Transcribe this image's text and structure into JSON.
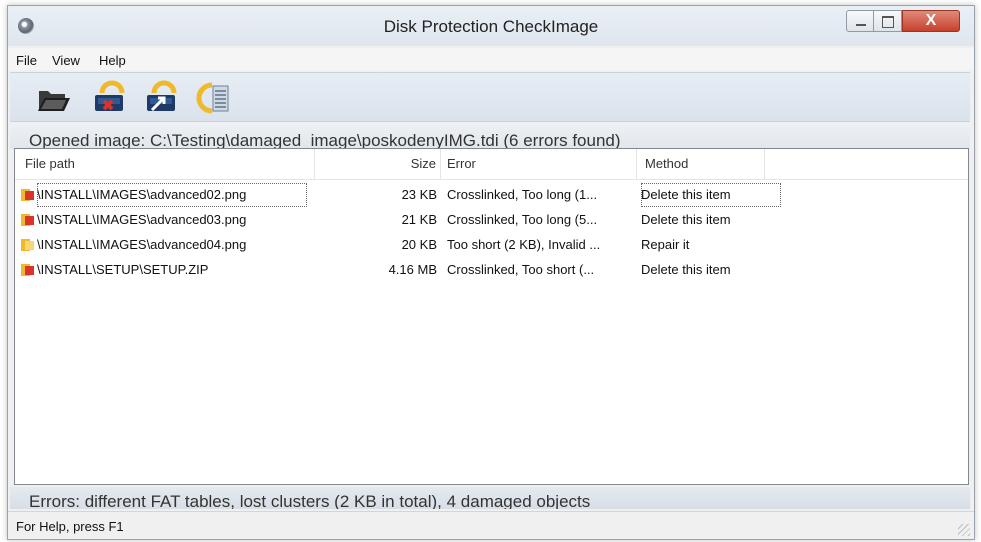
{
  "window": {
    "title": "Disk Protection CheckImage",
    "close_glyph": "X"
  },
  "menu": [
    "File",
    "View",
    "Help"
  ],
  "toolbar": {
    "buttons": [
      {
        "icon": "open-folder-icon"
      },
      {
        "icon": "delete-disk-icon"
      },
      {
        "icon": "repair-disk-icon"
      },
      {
        "icon": "disk-details-icon"
      }
    ]
  },
  "info": {
    "opened_text": "Opened image:  C:\\Testing\\damaged_image\\poskodenyIMG.tdi  (6 errors found)"
  },
  "table": {
    "columns": [
      "File path",
      "Size",
      "Error",
      "Method"
    ],
    "rows": [
      {
        "path": "\\INSTALL\\IMAGES\\advanced02.png",
        "size": "23 KB",
        "error": "Crosslinked, Too long (1...",
        "method": "Delete this item",
        "icon": "error-file-icon"
      },
      {
        "path": "\\INSTALL\\IMAGES\\advanced03.png",
        "size": "21 KB",
        "error": "Crosslinked, Too long (5...",
        "method": "Delete this item",
        "icon": "error-file-icon"
      },
      {
        "path": "\\INSTALL\\IMAGES\\advanced04.png",
        "size": "20 KB",
        "error": "Too short (2 KB), Invalid ...",
        "method": "Repair it",
        "icon": "warning-file-icon"
      },
      {
        "path": "\\INSTALL\\SETUP\\SETUP.ZIP",
        "size": "4.16 MB",
        "error": "Crosslinked, Too short (...",
        "method": "Delete this item",
        "icon": "error-file-icon"
      }
    ]
  },
  "errors": {
    "text": "Errors:  different FAT tables,  lost clusters (2 KB in total),  4 damaged objects"
  },
  "status": {
    "text": "For Help, press F1"
  },
  "colors": {
    "error_icon": "#d9342b",
    "warning_icon": "#f0b92c",
    "toolbar_bg": "#dde4ec"
  }
}
